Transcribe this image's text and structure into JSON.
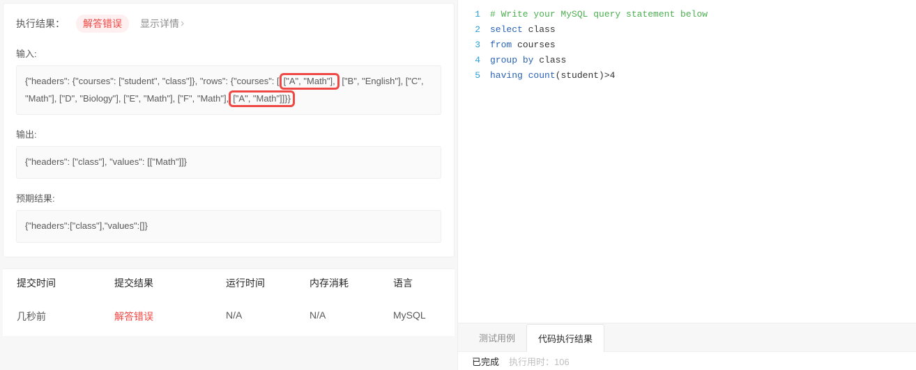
{
  "left": {
    "header": {
      "label": "执行结果：",
      "status": "解答错误",
      "detail_link": "显示详情"
    },
    "input_label": "输入:",
    "input_segments": {
      "pre1": "{\"headers\": {\"courses\": [\"student\", \"class\"]}, \"rows\": {\"courses\": [",
      "hl1": "[\"A\", \"Math\"],",
      "mid": " [\"B\", \"English\"], [\"C\", \"Math\"], [\"D\", \"Biology\"], [\"E\", \"Math\"], [\"F\", \"Math\"],",
      "hl2": " [\"A\", \"Math\"]]}}"
    },
    "output_label": "输出:",
    "output_text": "{\"headers\": [\"class\"], \"values\": [[\"Math\"]]}",
    "expected_label": "预期结果:",
    "expected_text": "{\"headers\":[\"class\"],\"values\":[]}",
    "table": {
      "headers": {
        "time": "提交时间",
        "result": "提交结果",
        "runtime": "运行时间",
        "memory": "内存消耗",
        "lang": "语言"
      },
      "row": {
        "time": "几秒前",
        "result": "解答错误",
        "runtime": "N/A",
        "memory": "N/A",
        "lang": "MySQL"
      }
    }
  },
  "editor": {
    "lines": [
      {
        "n": "1",
        "tokens": [
          {
            "t": "# Write your MySQL query statement below",
            "c": "tok-comment"
          }
        ]
      },
      {
        "n": "2",
        "tokens": [
          {
            "t": "select",
            "c": "tok-keyword"
          },
          {
            "t": " class",
            "c": "tok-plain"
          }
        ]
      },
      {
        "n": "3",
        "tokens": [
          {
            "t": "from",
            "c": "tok-keyword"
          },
          {
            "t": " courses",
            "c": "tok-plain"
          }
        ]
      },
      {
        "n": "4",
        "tokens": [
          {
            "t": "group",
            "c": "tok-keyword"
          },
          {
            "t": " ",
            "c": "tok-plain"
          },
          {
            "t": "by",
            "c": "tok-keyword"
          },
          {
            "t": " class",
            "c": "tok-plain"
          }
        ]
      },
      {
        "n": "5",
        "tokens": [
          {
            "t": "having",
            "c": "tok-keyword"
          },
          {
            "t": " ",
            "c": "tok-plain"
          },
          {
            "t": "count",
            "c": "tok-func"
          },
          {
            "t": "(student)>",
            "c": "tok-plain"
          },
          {
            "t": "4",
            "c": "tok-num"
          }
        ]
      }
    ]
  },
  "bottom": {
    "tab_testcase": "测试用例",
    "tab_result": "代码执行结果",
    "status_done": "已完成",
    "status_timing": "执行用时：106"
  }
}
